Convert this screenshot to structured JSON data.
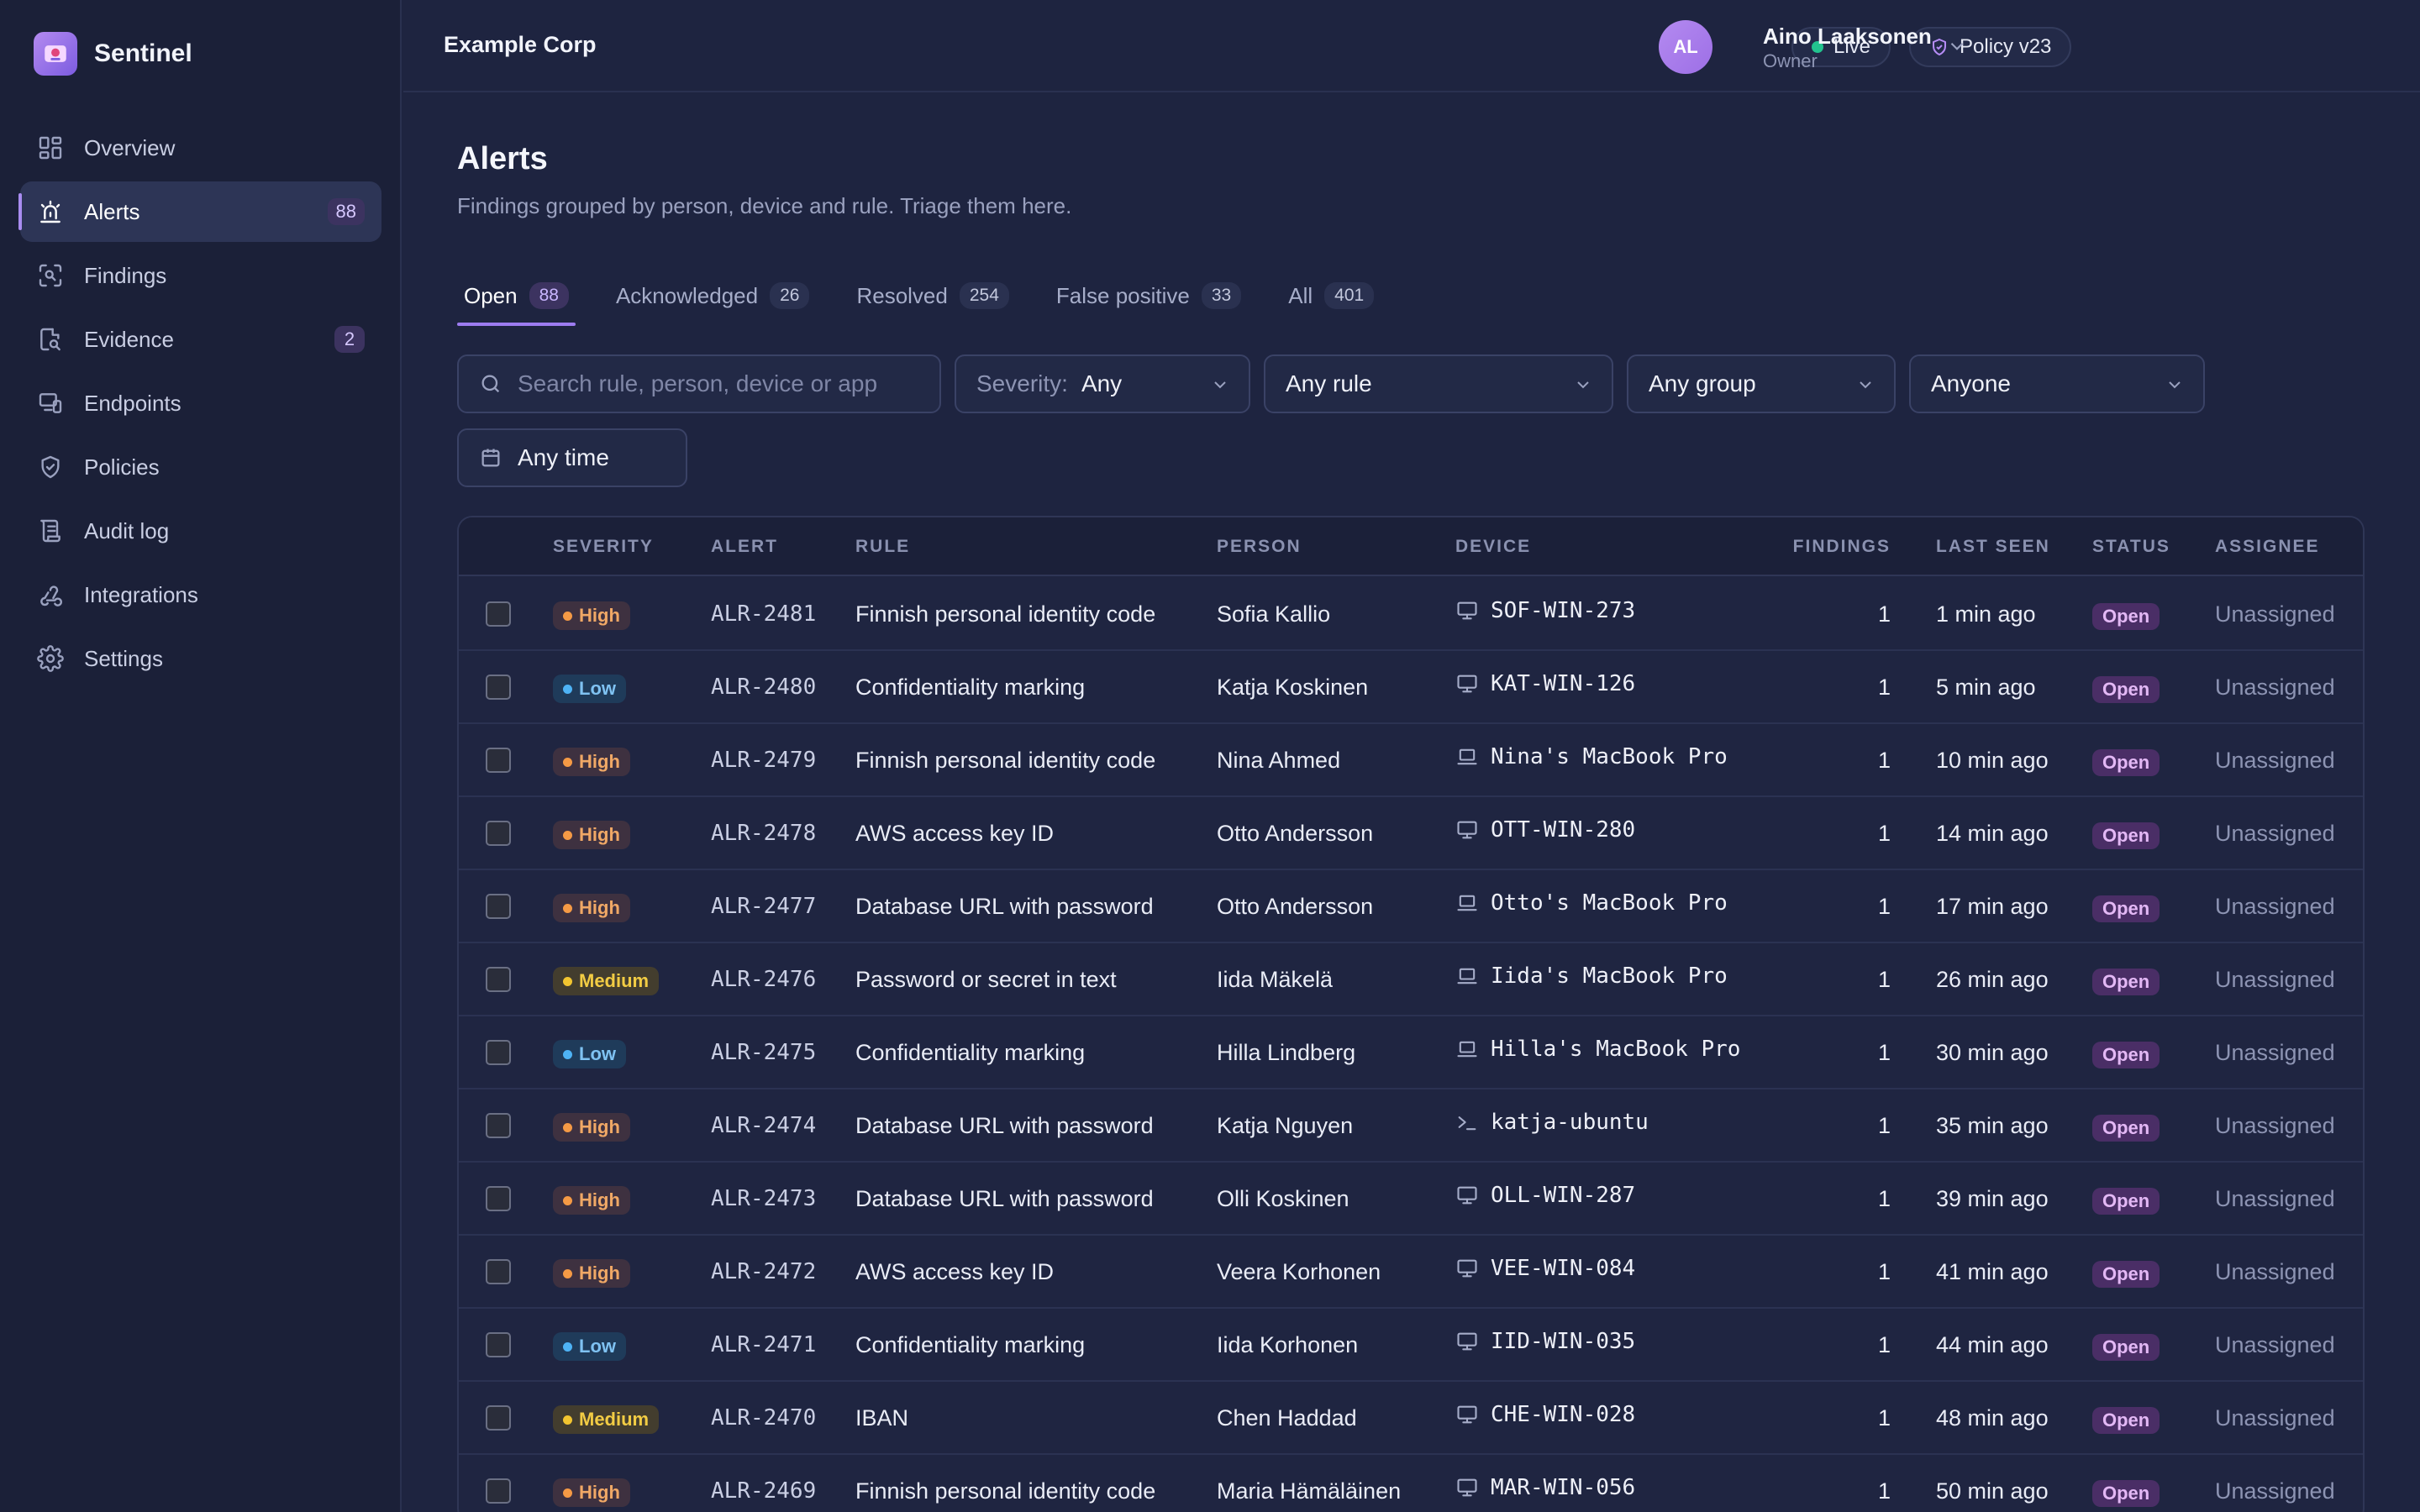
{
  "brand": {
    "name": "Sentinel"
  },
  "sidebar": {
    "items": [
      {
        "label": "Overview",
        "icon": "grid-icon",
        "badge": null,
        "active": false
      },
      {
        "label": "Alerts",
        "icon": "siren-icon",
        "badge": "88",
        "active": true
      },
      {
        "label": "Findings",
        "icon": "scan-icon",
        "badge": null,
        "active": false
      },
      {
        "label": "Evidence",
        "icon": "file-search-icon",
        "badge": "2",
        "active": false
      },
      {
        "label": "Endpoints",
        "icon": "devices-icon",
        "badge": null,
        "active": false
      },
      {
        "label": "Policies",
        "icon": "shield-check-icon",
        "badge": null,
        "active": false
      },
      {
        "label": "Audit log",
        "icon": "scroll-icon",
        "badge": null,
        "active": false
      },
      {
        "label": "Integrations",
        "icon": "webhook-icon",
        "badge": null,
        "active": false
      },
      {
        "label": "Settings",
        "icon": "gear-icon",
        "badge": null,
        "active": false
      }
    ]
  },
  "header": {
    "org": "Example Corp",
    "live_label": "Live",
    "policy_label": "Policy v23",
    "user": {
      "initials": "AL",
      "name": "Aino Laaksonen",
      "role": "Owner"
    }
  },
  "page": {
    "title": "Alerts",
    "subtitle": "Findings grouped by person, device and rule. Triage them here."
  },
  "tabs": [
    {
      "label": "Open",
      "count": "88",
      "active": true
    },
    {
      "label": "Acknowledged",
      "count": "26",
      "active": false
    },
    {
      "label": "Resolved",
      "count": "254",
      "active": false
    },
    {
      "label": "False positive",
      "count": "33",
      "active": false
    },
    {
      "label": "All",
      "count": "401",
      "active": false
    }
  ],
  "filters": {
    "search_placeholder": "Search rule, person, device or app",
    "severity_label": "Severity:",
    "severity_value": "Any",
    "rule_value": "Any rule",
    "group_value": "Any group",
    "assignee_value": "Anyone",
    "time_value": "Any time"
  },
  "table": {
    "columns": [
      "SEVERITY",
      "ALERT",
      "RULE",
      "PERSON",
      "DEVICE",
      "FINDINGS",
      "LAST SEEN",
      "STATUS",
      "ASSIGNEE"
    ],
    "rows": [
      {
        "severity": "High",
        "sev": "high",
        "alert": "ALR-2481",
        "rule": "Finnish personal identity code",
        "person": "Sofia Kallio",
        "device_icon": "desktop-icon",
        "device": "SOF-WIN-273",
        "findings": "1",
        "last_seen": "1 min ago",
        "status": "Open",
        "assignee": "Unassigned"
      },
      {
        "severity": "Low",
        "sev": "low",
        "alert": "ALR-2480",
        "rule": "Confidentiality marking",
        "person": "Katja Koskinen",
        "device_icon": "desktop-icon",
        "device": "KAT-WIN-126",
        "findings": "1",
        "last_seen": "5 min ago",
        "status": "Open",
        "assignee": "Unassigned"
      },
      {
        "severity": "High",
        "sev": "high",
        "alert": "ALR-2479",
        "rule": "Finnish personal identity code",
        "person": "Nina Ahmed",
        "device_icon": "laptop-icon",
        "device": "Nina's MacBook Pro",
        "findings": "1",
        "last_seen": "10 min ago",
        "status": "Open",
        "assignee": "Unassigned"
      },
      {
        "severity": "High",
        "sev": "high",
        "alert": "ALR-2478",
        "rule": "AWS access key ID",
        "person": "Otto Andersson",
        "device_icon": "desktop-icon",
        "device": "OTT-WIN-280",
        "findings": "1",
        "last_seen": "14 min ago",
        "status": "Open",
        "assignee": "Unassigned"
      },
      {
        "severity": "High",
        "sev": "high",
        "alert": "ALR-2477",
        "rule": "Database URL with password",
        "person": "Otto Andersson",
        "device_icon": "laptop-icon",
        "device": "Otto's MacBook Pro",
        "findings": "1",
        "last_seen": "17 min ago",
        "status": "Open",
        "assignee": "Unassigned"
      },
      {
        "severity": "Medium",
        "sev": "medium",
        "alert": "ALR-2476",
        "rule": "Password or secret in text",
        "person": "Iida Mäkelä",
        "device_icon": "laptop-icon",
        "device": "Iida's MacBook Pro",
        "findings": "1",
        "last_seen": "26 min ago",
        "status": "Open",
        "assignee": "Unassigned"
      },
      {
        "severity": "Low",
        "sev": "low",
        "alert": "ALR-2475",
        "rule": "Confidentiality marking",
        "person": "Hilla Lindberg",
        "device_icon": "laptop-icon",
        "device": "Hilla's MacBook Pro",
        "findings": "1",
        "last_seen": "30 min ago",
        "status": "Open",
        "assignee": "Unassigned"
      },
      {
        "severity": "High",
        "sev": "high",
        "alert": "ALR-2474",
        "rule": "Database URL with password",
        "person": "Katja Nguyen",
        "device_icon": "terminal-icon",
        "device": "katja-ubuntu",
        "findings": "1",
        "last_seen": "35 min ago",
        "status": "Open",
        "assignee": "Unassigned"
      },
      {
        "severity": "High",
        "sev": "high",
        "alert": "ALR-2473",
        "rule": "Database URL with password",
        "person": "Olli Koskinen",
        "device_icon": "desktop-icon",
        "device": "OLL-WIN-287",
        "findings": "1",
        "last_seen": "39 min ago",
        "status": "Open",
        "assignee": "Unassigned"
      },
      {
        "severity": "High",
        "sev": "high",
        "alert": "ALR-2472",
        "rule": "AWS access key ID",
        "person": "Veera Korhonen",
        "device_icon": "desktop-icon",
        "device": "VEE-WIN-084",
        "findings": "1",
        "last_seen": "41 min ago",
        "status": "Open",
        "assignee": "Unassigned"
      },
      {
        "severity": "Low",
        "sev": "low",
        "alert": "ALR-2471",
        "rule": "Confidentiality marking",
        "person": "Iida Korhonen",
        "device_icon": "desktop-icon",
        "device": "IID-WIN-035",
        "findings": "1",
        "last_seen": "44 min ago",
        "status": "Open",
        "assignee": "Unassigned"
      },
      {
        "severity": "Medium",
        "sev": "medium",
        "alert": "ALR-2470",
        "rule": "IBAN",
        "person": "Chen Haddad",
        "device_icon": "desktop-icon",
        "device": "CHE-WIN-028",
        "findings": "1",
        "last_seen": "48 min ago",
        "status": "Open",
        "assignee": "Unassigned"
      },
      {
        "severity": "High",
        "sev": "high",
        "alert": "ALR-2469",
        "rule": "Finnish personal identity code",
        "person": "Maria Hämäläinen",
        "device_icon": "desktop-icon",
        "device": "MAR-WIN-056",
        "findings": "1",
        "last_seen": "50 min ago",
        "status": "Open",
        "assignee": "Unassigned"
      }
    ]
  }
}
